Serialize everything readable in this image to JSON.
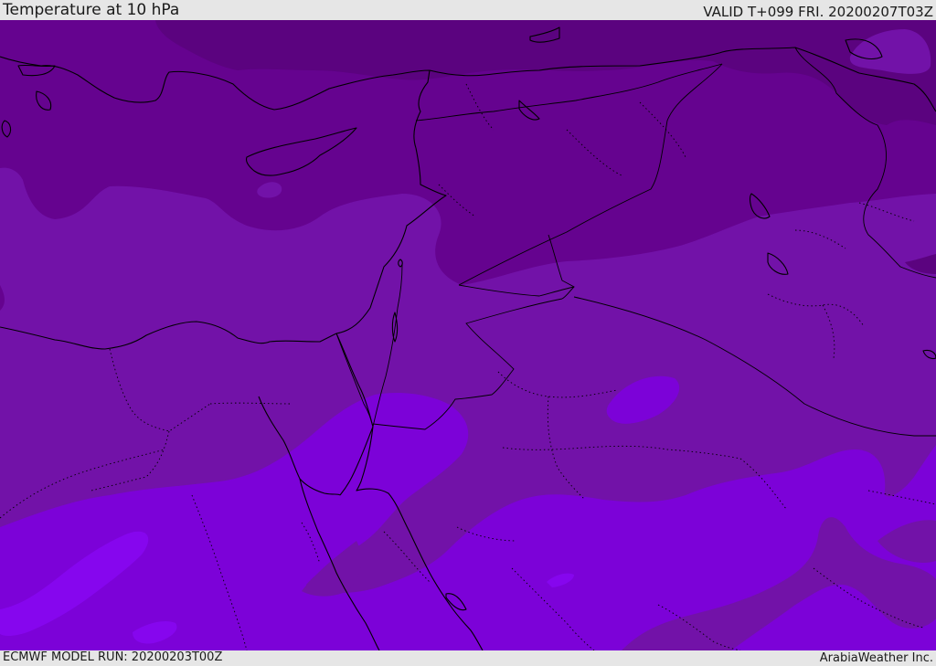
{
  "header": {
    "title": "Temperature at 10 hPa",
    "valid_time": "VALID T+099 FRI. 20200207T03Z"
  },
  "footer": {
    "model_run": "ECMWF MODEL RUN: 20200203T00Z",
    "credit": "ArabiaWeather Inc."
  },
  "map": {
    "variable": "Temperature",
    "level": "10 hPa",
    "contour_colors": {
      "darkest": "#5b037f",
      "dark": "#65038f",
      "mid": "#7212a8",
      "bright": "#7c02d8",
      "brightest": "#8606ee"
    },
    "coastline_color": "#000000"
  }
}
